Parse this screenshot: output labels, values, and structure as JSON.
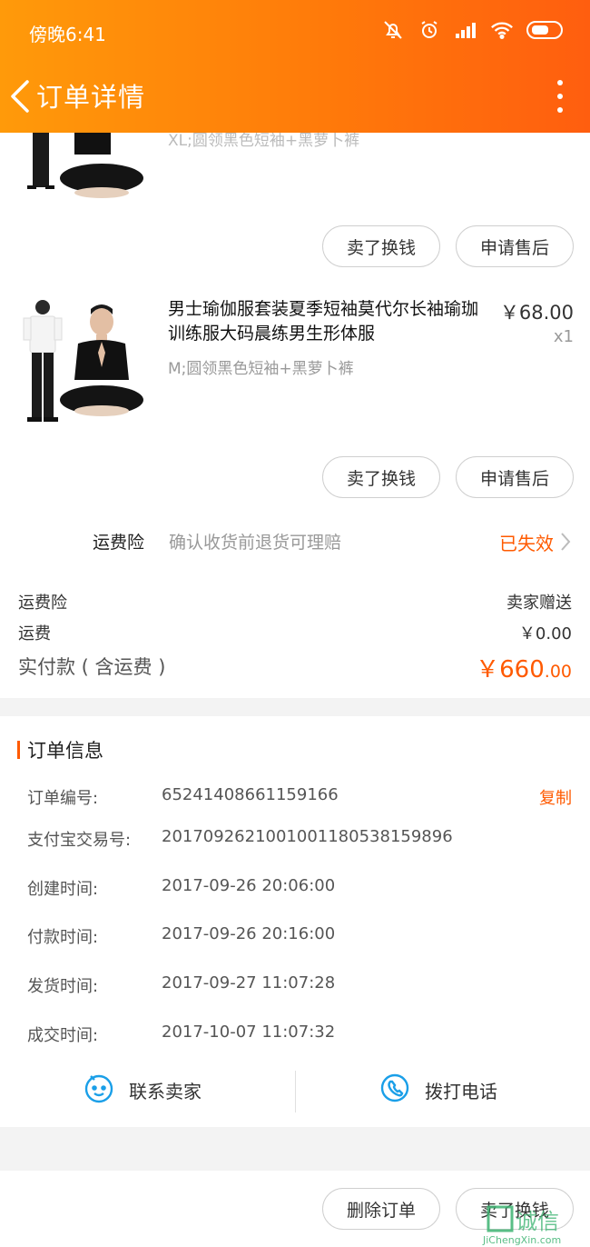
{
  "status_bar": {
    "time": "傍晚6:41"
  },
  "nav": {
    "title": "订单详情"
  },
  "product_partial": {
    "sku": "XL;圆领黑色短袖+黑萝卜裤",
    "buttons": {
      "sell": "卖了换钱",
      "after_sale": "申请售后"
    }
  },
  "product": {
    "title": "男士瑜伽服套装夏季短袖莫代尔长袖瑜珈训练服大码晨练男生形体服",
    "price": "￥68.00",
    "qty": "x1",
    "sku": "M;圆领黑色短袖+黑萝卜裤",
    "buttons": {
      "sell": "卖了换钱",
      "after_sale": "申请售后"
    }
  },
  "insurance": {
    "label": "运费险",
    "desc": "确认收货前退货可理赔",
    "status": "已失效"
  },
  "summary": {
    "rows": [
      {
        "label": "运费险",
        "value": "卖家赠送"
      },
      {
        "label": "运费",
        "value": "￥0.00"
      }
    ],
    "total_label": "实付款 ( 含运费 )",
    "total_value_main": "￥660",
    "total_value_cents": ".00"
  },
  "order_info": {
    "title": "订单信息",
    "copy_label": "复制",
    "rows": [
      {
        "label": "订单编号:",
        "value": "65241408661159166"
      },
      {
        "label": "支付宝交易号:",
        "value": "2017092621001001180538159896"
      },
      {
        "label": "创建时间:",
        "value": "2017-09-26 20:06:00"
      },
      {
        "label": "付款时间:",
        "value": "2017-09-26 20:16:00"
      },
      {
        "label": "发货时间:",
        "value": "2017-09-27 11:07:28"
      },
      {
        "label": "成交时间:",
        "value": "2017-10-07 11:07:32"
      }
    ]
  },
  "contact": {
    "seller": "联系卖家",
    "call": "拨打电话"
  },
  "bottom": {
    "delete": "删除订单",
    "sell": "卖了换钱"
  },
  "colors": {
    "accent": "#ff5a00",
    "header_start": "#ff9a0a",
    "header_end": "#ff5e0f",
    "icon_blue": "#1a9fe8"
  },
  "watermark": {
    "text_cn": "诚信",
    "text_en": "JiChengXin.com"
  }
}
